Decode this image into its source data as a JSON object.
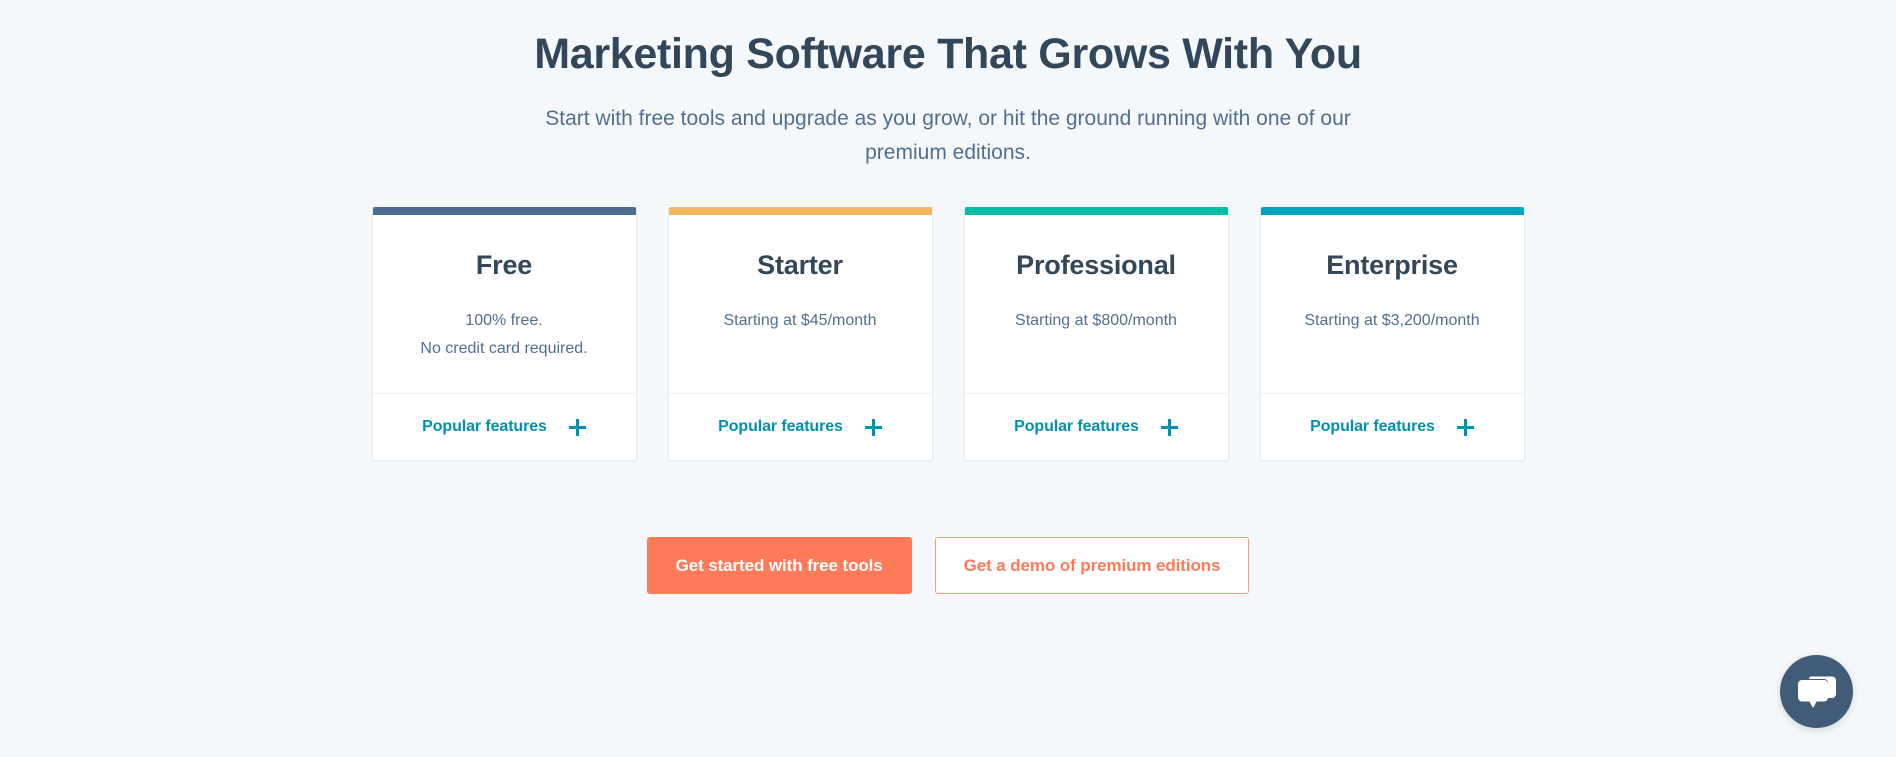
{
  "header": {
    "headline": "Marketing Software That Grows With You",
    "subhead": "Start with free tools and upgrade as you grow, or hit the ground running with one of our premium editions."
  },
  "colors": {
    "background": "#f5f8fa",
    "headline_text": "#33475b",
    "body_text": "#516f90",
    "accent_teal": "#0091ae",
    "accent_coral": "#ff7a59",
    "chat_bubble": "#425b76"
  },
  "plans": [
    {
      "name": "Free",
      "price_lines": [
        "100% free.",
        "No credit card required."
      ],
      "accent": "#4d6c8f",
      "features_label": "Popular features",
      "expand_icon": "plus-icon"
    },
    {
      "name": "Starter",
      "price_lines": [
        "Starting at $45/month"
      ],
      "accent": "#f2b861",
      "features_label": "Popular features",
      "expand_icon": "plus-icon"
    },
    {
      "name": "Professional",
      "price_lines": [
        "Starting at $800/month"
      ],
      "accent": "#00bda5",
      "features_label": "Popular features",
      "expand_icon": "plus-icon"
    },
    {
      "name": "Enterprise",
      "price_lines": [
        "Starting at $3,200/month"
      ],
      "accent": "#00a4bd",
      "features_label": "Popular features",
      "expand_icon": "plus-icon"
    }
  ],
  "cta": {
    "primary_label": "Get started with free tools",
    "secondary_label": "Get a demo of premium editions"
  },
  "chat": {
    "icon": "chat-bubbles-icon"
  }
}
